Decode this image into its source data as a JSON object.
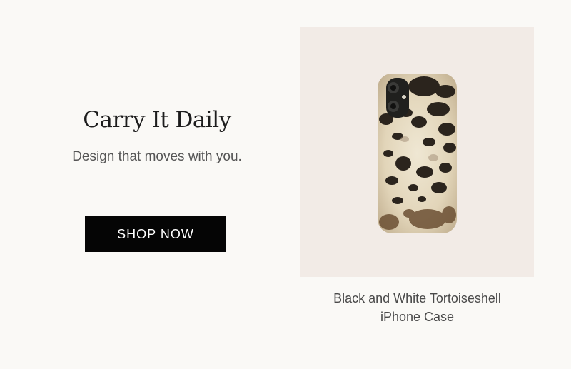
{
  "promo": {
    "headline": "Carry It Daily",
    "subhead": "Design that moves with you.",
    "button_label": "SHOP NOW"
  },
  "product": {
    "title_line1": "Black and White Tortoiseshell",
    "title_line2": "iPhone Case",
    "image_icon": "phone-case-image",
    "card_background": "#f2ebe6"
  },
  "colors": {
    "page_background": "#faf9f6",
    "button_background": "#050505",
    "button_text": "#ffffff"
  }
}
